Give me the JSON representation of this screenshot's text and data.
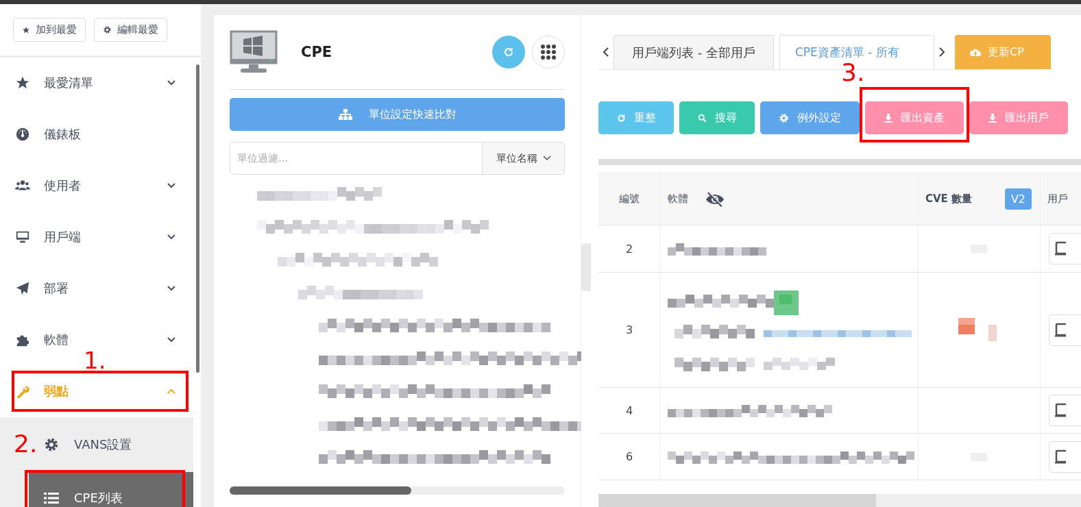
{
  "sidebar": {
    "favorite_buttons": [
      {
        "label": "加到最愛"
      },
      {
        "label": "編輯最愛"
      }
    ],
    "items": [
      {
        "label": "最愛清單",
        "expanded": false,
        "selected": false
      },
      {
        "label": "儀錶板",
        "selected": false
      },
      {
        "label": "使用者",
        "expanded": false,
        "selected": false
      },
      {
        "label": "用戶端",
        "expanded": false,
        "selected": false
      },
      {
        "label": "部署",
        "expanded": false,
        "selected": false
      },
      {
        "label": "軟體",
        "expanded": false,
        "selected": false
      },
      {
        "label": "弱點",
        "expanded": true,
        "selected": true,
        "children": [
          {
            "label": "VANS設置",
            "selected": false
          },
          {
            "label": "CPE列表",
            "selected": true
          }
        ]
      }
    ]
  },
  "unit_panel": {
    "title": "CPE",
    "compare_button": "單位設定快速比對",
    "filter": {
      "placeholder": "單位過濾..."
    },
    "filter_mode": "單位名稱"
  },
  "main": {
    "tabs": [
      {
        "label": "用戶端列表 - 全部用戶",
        "selected": false
      },
      {
        "label": "CPE資產清單 - 所有",
        "selected": true
      }
    ],
    "update_button": "更新CP",
    "toolbar": [
      {
        "label": "重整",
        "kind": "refresh"
      },
      {
        "label": "搜尋",
        "kind": "search"
      },
      {
        "label": "例外設定",
        "kind": "settings"
      },
      {
        "label": "匯出資產",
        "kind": "export"
      },
      {
        "label": "匯出用戶",
        "kind": "export"
      }
    ],
    "table": {
      "columns": [
        "編號",
        "軟體",
        "CVE 數量",
        "用戶"
      ],
      "version_badge": "V2",
      "rows": [
        {
          "number": "2"
        },
        {
          "number": "3"
        },
        {
          "number": "4"
        },
        {
          "number": "6"
        }
      ]
    }
  },
  "annotations": [
    {
      "label": "1."
    },
    {
      "label": "2."
    },
    {
      "label": "3."
    }
  ]
}
